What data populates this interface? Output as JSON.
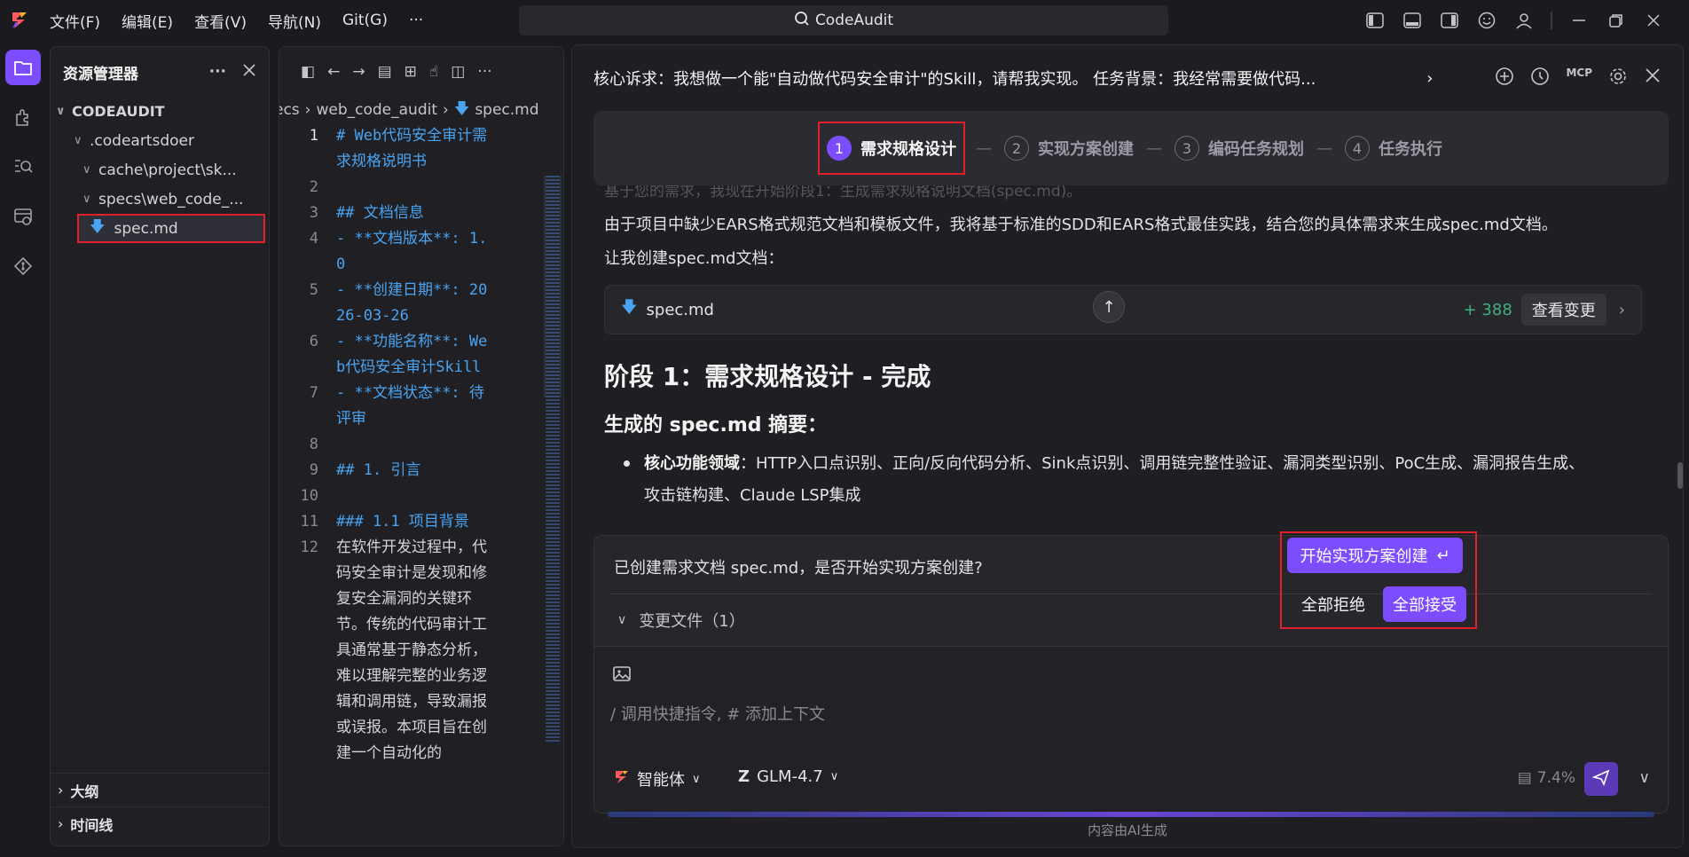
{
  "menubar": {
    "items": [
      "文件(F)",
      "编辑(E)",
      "查看(V)",
      "导航(N)",
      "Git(G)",
      "···"
    ],
    "search": "CodeAudit"
  },
  "explorer": {
    "title": "资源管理器",
    "root": "CODEAUDIT",
    "rows": [
      ".codeartsdoer",
      "cache\\project\\sk...",
      "specs\\web_code_...",
      "spec.md"
    ],
    "outline": "大纲",
    "timeline": "时间线"
  },
  "editor": {
    "breadcrumb": [
      "ecs",
      "web_code_audit",
      "spec.md"
    ],
    "lines": [
      {
        "n": "1",
        "t": "# Web代码安全审计需求规格说明书",
        "h": true
      },
      {
        "n": "2",
        "t": "",
        "h": false
      },
      {
        "n": "3",
        "t": "## 文档信息",
        "h": true
      },
      {
        "n": "4",
        "t": "- **文档版本**: 1.0",
        "h": true
      },
      {
        "n": "5",
        "t": "- **创建日期**: 2026-03-26",
        "h": true
      },
      {
        "n": "6",
        "t": "- **功能名称**: Web代码安全审计Skill",
        "h": true
      },
      {
        "n": "7",
        "t": "- **文档状态**: 待评审",
        "h": true
      },
      {
        "n": "8",
        "t": "",
        "h": false
      },
      {
        "n": "9",
        "t": "## 1. 引言",
        "h": true
      },
      {
        "n": "10",
        "t": "",
        "h": false
      },
      {
        "n": "11",
        "t": "### 1.1 项目背景",
        "h": true
      },
      {
        "n": "12",
        "t": "在软件开发过程中，代码安全审计是发现和修复安全漏洞的关键环节。传统的代码审计工具通常基于静态分析，难以理解完整的业务逻辑和调用链，导致漏报或误报。本项目旨在创建一个自动化的",
        "h": false
      }
    ]
  },
  "chat": {
    "title": "核心诉求：我想做一个能\"自动做代码安全审计\"的Skill，请帮我实现。 任务背景：我经常需要做代码...",
    "steps": [
      {
        "num": "1",
        "label": "需求规格设计",
        "active": true
      },
      {
        "num": "2",
        "label": "实现方案创建",
        "active": false
      },
      {
        "num": "3",
        "label": "编码任务规划",
        "active": false
      },
      {
        "num": "4",
        "label": "任务执行",
        "active": false
      }
    ],
    "faded_line": "基于您的需求，我现在开始阶段1：生成需求规格说明文档(spec.md)。",
    "para1": "由于项目中缺少EARS格式规范文档和模板文件，我将基于标准的SDD和EARS格式最佳实践，结合您的具体需求来生成spec.md文档。",
    "para2": "让我创建spec.md文档：",
    "file_card": {
      "name": "spec.md",
      "added": "+ 388",
      "view": "查看变更"
    },
    "h2": "阶段 1：需求规格设计 - 完成",
    "h3": "生成的 spec.md 摘要：",
    "bullet_label": "核心功能领域",
    "bullet_text": "：HTTP入口点识别、正向/反向代码分析、Sink点识别、调用链完整性验证、漏洞类型识别、PoC生成、漏洞报告生成、攻击链构建、Claude LSP集成",
    "confirm": {
      "question": "已创建需求文档 spec.md，是否开始实现方案创建?",
      "changes": "变更文件（1）",
      "start": "开始实现方案创建",
      "reject_all": "全部拒绝",
      "accept_all": "全部接受"
    },
    "input": {
      "placeholder": "/ 调用快捷指令, # 添加上下文",
      "agent": "智能体",
      "model": "GLM-4.7",
      "ctx": "7.4%"
    },
    "footer": "内容由AI生成"
  },
  "colors": {
    "accent": "#7c4dff",
    "highlight": "#e0202a",
    "added": "#3fb27f",
    "md_heading": "#4aa3f0"
  }
}
